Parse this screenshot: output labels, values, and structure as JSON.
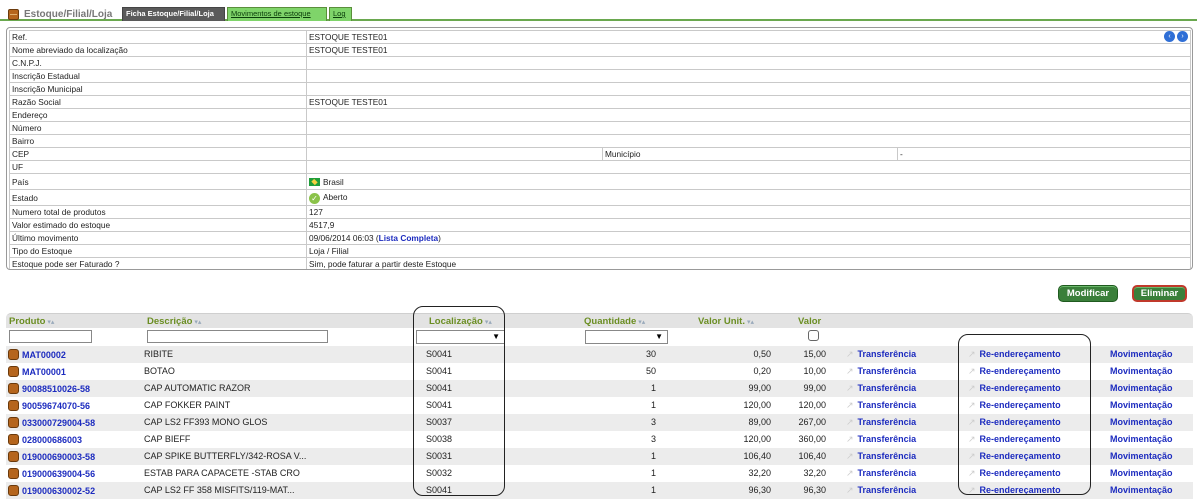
{
  "tabbar": {
    "app_title": "Estoque/Filial/Loja",
    "tabs": [
      {
        "label": "Ficha Estoque/Filial/Loja",
        "active": true
      },
      {
        "label": "Movimentos de estoque",
        "active": false
      },
      {
        "label": "Log",
        "active": false
      }
    ]
  },
  "nav": {
    "prev_icon": "arrow-left-circle-icon",
    "next_icon": "arrow-right-circle-icon",
    "prev_glyph": "‹",
    "next_glyph": "›"
  },
  "info": {
    "rows": [
      {
        "label": "Ref.",
        "value": "ESTOQUE TESTE01"
      },
      {
        "label": "Nome abreviado da localização",
        "value": "ESTOQUE TESTE01"
      },
      {
        "label": "C.N.P.J.",
        "value": ""
      },
      {
        "label": "Inscrição Estadual",
        "value": ""
      },
      {
        "label": "Inscrição Municipal",
        "value": ""
      },
      {
        "label": "Razão Social",
        "value": "ESTOQUE TESTE01"
      },
      {
        "label": "Endereço",
        "value": ""
      },
      {
        "label": "Número",
        "value": ""
      },
      {
        "label": "Bairro",
        "value": ""
      }
    ],
    "cep": {
      "label": "CEP",
      "value": "",
      "municipio_label": "Município",
      "municipio_value": "-"
    },
    "uf": {
      "label": "UF",
      "value": ""
    },
    "pais": {
      "label": "País",
      "value": "Brasil"
    },
    "estado": {
      "label": "Estado",
      "value": "Aberto"
    },
    "rows2": [
      {
        "label": "Numero total de produtos",
        "value": "127"
      },
      {
        "label": "Valor estimado do estoque",
        "value": "4517,9"
      }
    ],
    "ultimo": {
      "label": "Último movimento",
      "date": "09/06/2014 06:03",
      "open": "(",
      "link": "Lista Completa",
      "close": ")"
    },
    "rows3": [
      {
        "label": "Tipo do Estoque",
        "value": "Loja / Filial"
      },
      {
        "label": "Estoque pode ser Faturado ?",
        "value": "Sim, pode faturar a partir deste Estoque"
      }
    ]
  },
  "actions": {
    "modify": "Modificar",
    "delete": "Eliminar"
  },
  "grid": {
    "headers": {
      "produto": "Produto",
      "descricao": "Descrição",
      "localizacao": "Localização",
      "quantidade": "Quantidade",
      "valor_unit": "Valor Unit.",
      "valor": "Valor",
      "sort_glyph": "▾▴"
    },
    "filters": {
      "localizacao_select": "▼",
      "quantidade_select": "▼"
    },
    "rows": [
      {
        "code": "MAT00002",
        "desc": "RIBITE",
        "loc": "S0041",
        "qty": "30",
        "unit": "0,50",
        "value": "15,00"
      },
      {
        "code": "MAT00001",
        "desc": "BOTAO",
        "loc": "S0041",
        "qty": "50",
        "unit": "0,20",
        "value": "10,00"
      },
      {
        "code": "90088510026-58",
        "desc": "CAP AUTOMATIC RAZOR",
        "loc": "S0041",
        "qty": "1",
        "unit": "99,00",
        "value": "99,00"
      },
      {
        "code": "90059674070-56",
        "desc": "CAP FOKKER PAINT",
        "loc": "S0041",
        "qty": "1",
        "unit": "120,00",
        "value": "120,00"
      },
      {
        "code": "033000729004-58",
        "desc": "CAP LS2 FF393 MONO GLOS",
        "loc": "S0037",
        "qty": "3",
        "unit": "89,00",
        "value": "267,00"
      },
      {
        "code": "028000686003",
        "desc": "CAP BIEFF",
        "loc": "S0038",
        "qty": "3",
        "unit": "120,00",
        "value": "360,00"
      },
      {
        "code": "019000690003-58",
        "desc": "CAP SPIKE BUTTERFLY/342-ROSA V...",
        "loc": "S0031",
        "qty": "1",
        "unit": "106,40",
        "value": "106,40"
      },
      {
        "code": "019000639004-56",
        "desc": "ESTAB PARA CAPACETE -STAB CRO",
        "loc": "S0032",
        "qty": "1",
        "unit": "32,20",
        "value": "32,20"
      },
      {
        "code": "019000630002-52",
        "desc": "CAP LS2 FF 358 MISFITS/119-MAT...",
        "loc": "S0041",
        "qty": "1",
        "unit": "96,30",
        "value": "96,30"
      }
    ],
    "row_actions": {
      "transfer": "Transferência",
      "readdress": "Re-endereçamento",
      "movement": "Movimentação",
      "arrow_glyph": "↗"
    }
  }
}
